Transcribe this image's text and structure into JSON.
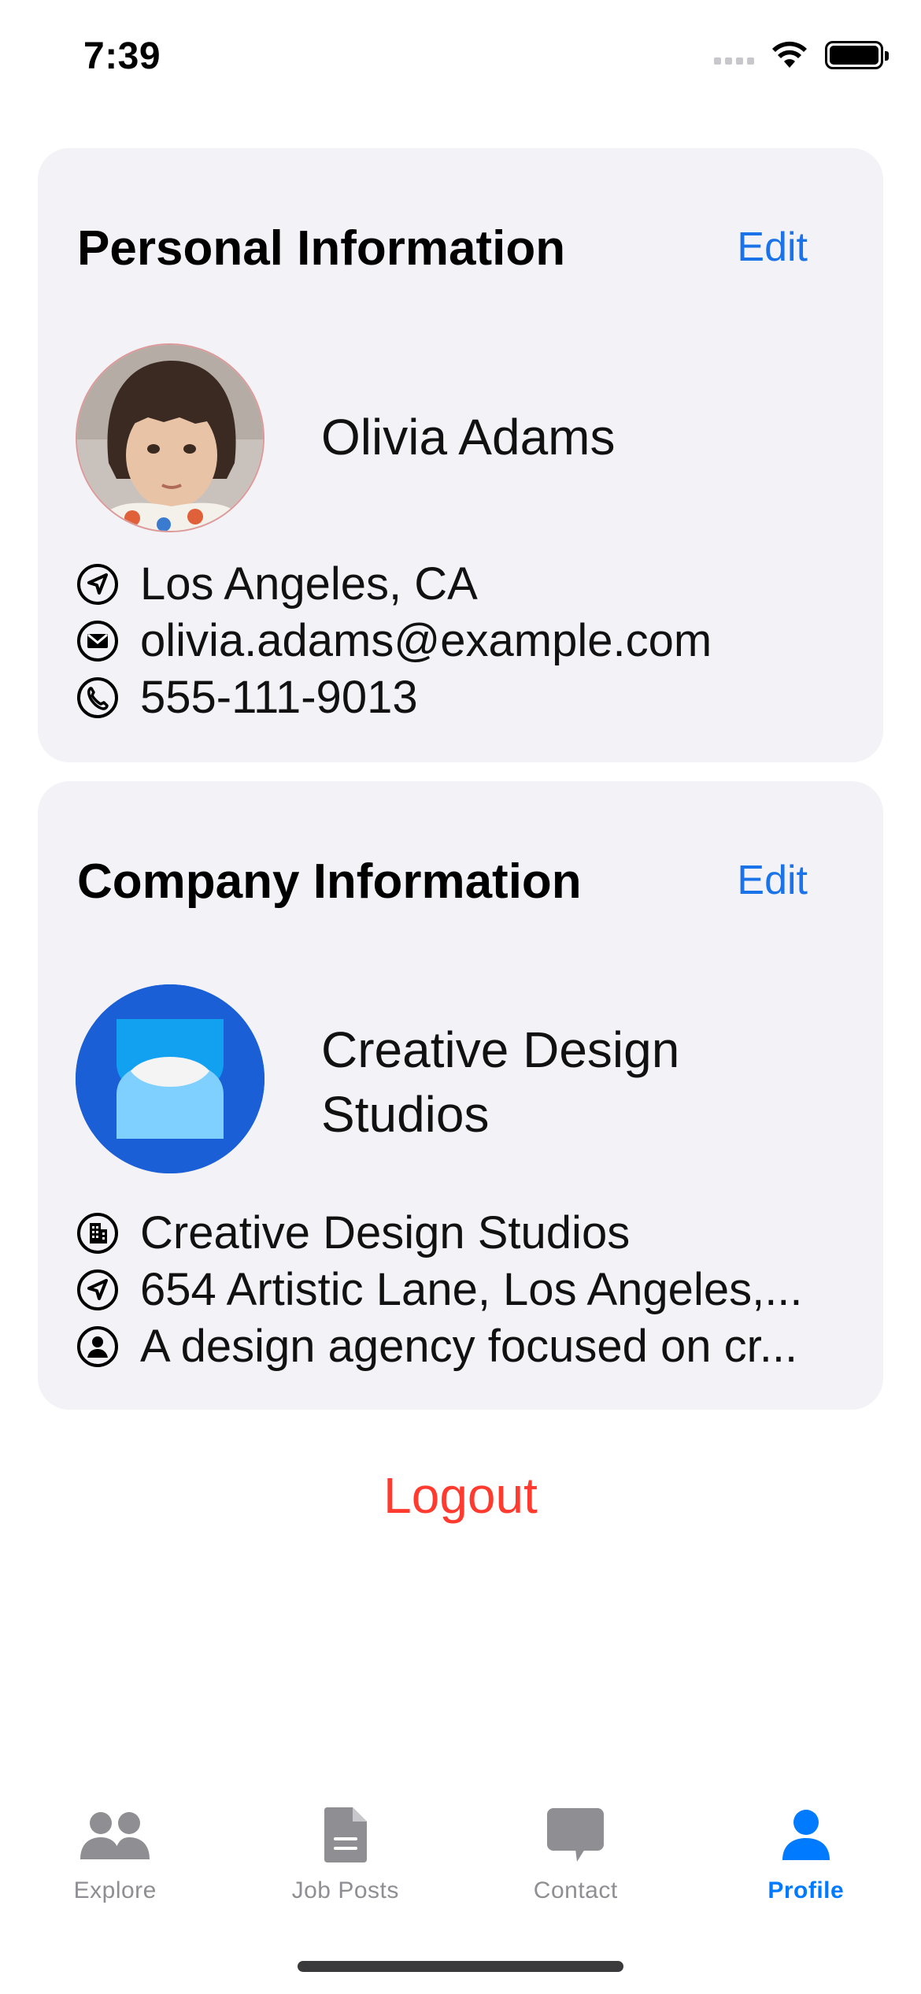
{
  "status_bar": {
    "time": "7:39"
  },
  "personal": {
    "title": "Personal Information",
    "edit_label": "Edit",
    "name": "Olivia Adams",
    "location": "Los Angeles, CA",
    "email": "olivia.adams@example.com",
    "phone": "555-111-9013"
  },
  "company": {
    "title": "Company Information",
    "edit_label": "Edit",
    "name": "Creative Design Studios",
    "company_name": "Creative Design Studios",
    "address": "654 Artistic Lane, Los Angeles,...",
    "description": "A design agency focused on cr..."
  },
  "logout_label": "Logout",
  "tabs": [
    {
      "label": "Explore",
      "icon": "people-icon",
      "active": false
    },
    {
      "label": "Job Posts",
      "icon": "document-icon",
      "active": false
    },
    {
      "label": "Contact",
      "icon": "chat-bubble-icon",
      "active": false
    },
    {
      "label": "Profile",
      "icon": "person-icon",
      "active": true
    }
  ],
  "colors": {
    "accent": "#007aff",
    "edit_link": "#1a73e8",
    "logout": "#ff3b30",
    "card_bg": "#f2f2f7",
    "tab_inactive": "#8e8e93"
  }
}
